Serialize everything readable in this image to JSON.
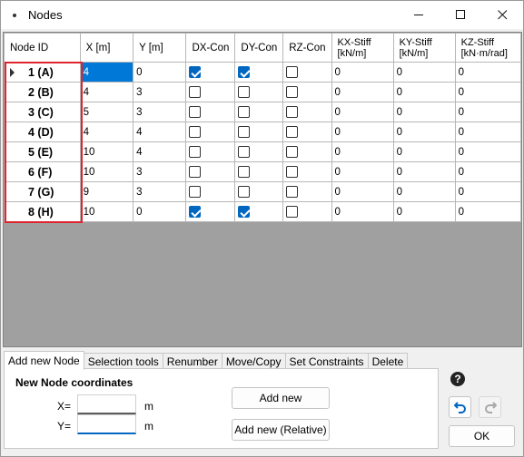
{
  "window": {
    "title": "Nodes"
  },
  "grid": {
    "columns": [
      {
        "key": "id",
        "label": "Node ID"
      },
      {
        "key": "x",
        "label": "X [m]"
      },
      {
        "key": "y",
        "label": "Y [m]"
      },
      {
        "key": "dx",
        "label": "DX-Con"
      },
      {
        "key": "dy",
        "label": "DY-Con"
      },
      {
        "key": "rz",
        "label": "RZ-Con"
      },
      {
        "key": "kx",
        "label": "KX-Stiff [kN/m]"
      },
      {
        "key": "ky",
        "label": "KY-Stiff [kN/m]"
      },
      {
        "key": "kz",
        "label": "KZ-Stiff [kN·m/rad]"
      }
    ],
    "rows": [
      {
        "id": "1 (A)",
        "x": "4",
        "y": "0",
        "dx": true,
        "dy": true,
        "rz": false,
        "kx": "0",
        "ky": "0",
        "kz": "0"
      },
      {
        "id": "2 (B)",
        "x": "4",
        "y": "3",
        "dx": false,
        "dy": false,
        "rz": false,
        "kx": "0",
        "ky": "0",
        "kz": "0"
      },
      {
        "id": "3 (C)",
        "x": "5",
        "y": "3",
        "dx": false,
        "dy": false,
        "rz": false,
        "kx": "0",
        "ky": "0",
        "kz": "0"
      },
      {
        "id": "4 (D)",
        "x": "4",
        "y": "4",
        "dx": false,
        "dy": false,
        "rz": false,
        "kx": "0",
        "ky": "0",
        "kz": "0"
      },
      {
        "id": "5 (E)",
        "x": "10",
        "y": "4",
        "dx": false,
        "dy": false,
        "rz": false,
        "kx": "0",
        "ky": "0",
        "kz": "0"
      },
      {
        "id": "6 (F)",
        "x": "10",
        "y": "3",
        "dx": false,
        "dy": false,
        "rz": false,
        "kx": "0",
        "ky": "0",
        "kz": "0"
      },
      {
        "id": "7 (G)",
        "x": "9",
        "y": "3",
        "dx": false,
        "dy": false,
        "rz": false,
        "kx": "0",
        "ky": "0",
        "kz": "0"
      },
      {
        "id": "8 (H)",
        "x": "10",
        "y": "0",
        "dx": true,
        "dy": true,
        "rz": false,
        "kx": "0",
        "ky": "0",
        "kz": "0"
      }
    ],
    "current_row": 0,
    "selected_cell": {
      "row": 0,
      "col": "x"
    },
    "highlight_color": "#e0242d",
    "selection_color": "#0078d7"
  },
  "tabs": [
    "Add new Node",
    "Selection tools",
    "Renumber",
    "Move/Copy",
    "Set Constraints",
    "Delete"
  ],
  "active_tab": 0,
  "panel": {
    "heading": "New Node coordinates",
    "x_label": "X=",
    "y_label": "Y=",
    "x_value": "",
    "y_value": "",
    "unit": "m",
    "add_new_label": "Add new",
    "add_relative_label": "Add new (Relative)"
  },
  "actions": {
    "help_icon": "?",
    "ok_label": "OK"
  },
  "icons": {
    "window": "app-icon",
    "minimize": "minimize-icon",
    "maximize": "maximize-icon",
    "close": "close-icon",
    "undo": "undo-icon",
    "redo": "redo-icon",
    "row_pointer": "row-pointer-icon"
  }
}
